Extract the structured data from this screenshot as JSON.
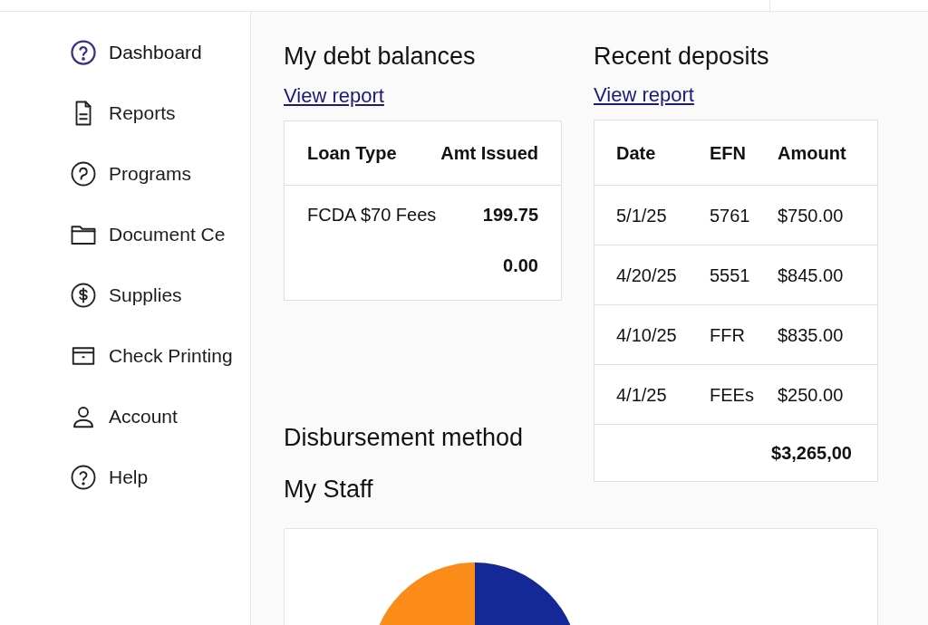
{
  "sidebar": {
    "items": [
      {
        "label": "Dashboard",
        "kind": "help",
        "selected": true
      },
      {
        "label": "Reports",
        "kind": "file",
        "selected": false
      },
      {
        "label": "Programs",
        "kind": "program",
        "selected": false
      },
      {
        "label": "Document Ce",
        "kind": "folder",
        "selected": false
      },
      {
        "label": "Supplies",
        "kind": "dollar",
        "selected": false
      },
      {
        "label": "Check Printing",
        "kind": "check",
        "selected": false
      },
      {
        "label": "Account",
        "kind": "user",
        "selected": false
      },
      {
        "label": "Help",
        "kind": "help",
        "selected": false
      }
    ]
  },
  "debt": {
    "title": "My debt balances",
    "link": "View report",
    "columns": [
      "Loan Type",
      "Amt Issued"
    ],
    "rows": [
      [
        "FCDA $70 Fees",
        "199.75"
      ],
      [
        "",
        "0.00"
      ]
    ]
  },
  "deposits": {
    "title": "Recent deposits",
    "link": "View report",
    "columns": [
      "Date",
      "EFN",
      "Amount"
    ],
    "rows": [
      [
        "5/1/25",
        "5761",
        "$750.00"
      ],
      [
        "4/20/25",
        "5551",
        "$845.00"
      ],
      [
        "4/10/25",
        "FFR",
        "$835.00"
      ],
      [
        "4/1/25",
        "FEEs",
        "$250.00"
      ]
    ],
    "total": "$3,265,00"
  },
  "disbursement": {
    "title": "Disbursement method"
  },
  "staff": {
    "title": "My Staff"
  }
}
